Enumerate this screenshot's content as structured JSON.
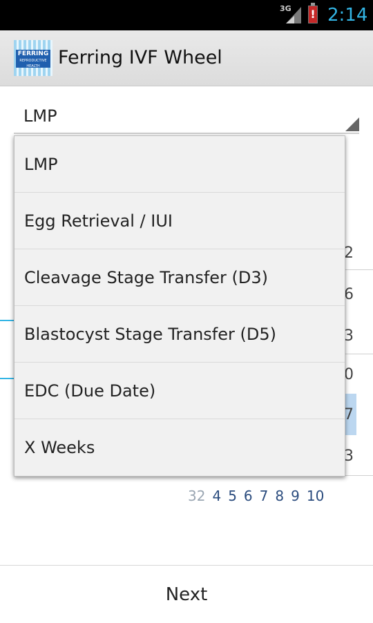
{
  "status_bar": {
    "network": "3G",
    "time": "2:14"
  },
  "action_bar": {
    "logo_text": "FERRING",
    "logo_subtext": "REPRODUCTIVE HEALTH",
    "title": "Ferring IVF Wheel"
  },
  "spinner": {
    "selected": "LMP"
  },
  "dropdown": {
    "options": [
      "LMP",
      "Egg Retrieval / IUI",
      "Cleavage Stage Transfer (D3)",
      "Blastocyst Stage Transfer (D5)",
      "EDC (Due Date)",
      "X Weeks"
    ]
  },
  "background": {
    "right_digits": [
      "2",
      "6",
      "3",
      "0",
      "7",
      "3"
    ],
    "week_numbers": [
      "32",
      "4",
      "5",
      "6",
      "7",
      "8",
      "9",
      "10"
    ]
  },
  "footer": {
    "next_label": "Next"
  }
}
